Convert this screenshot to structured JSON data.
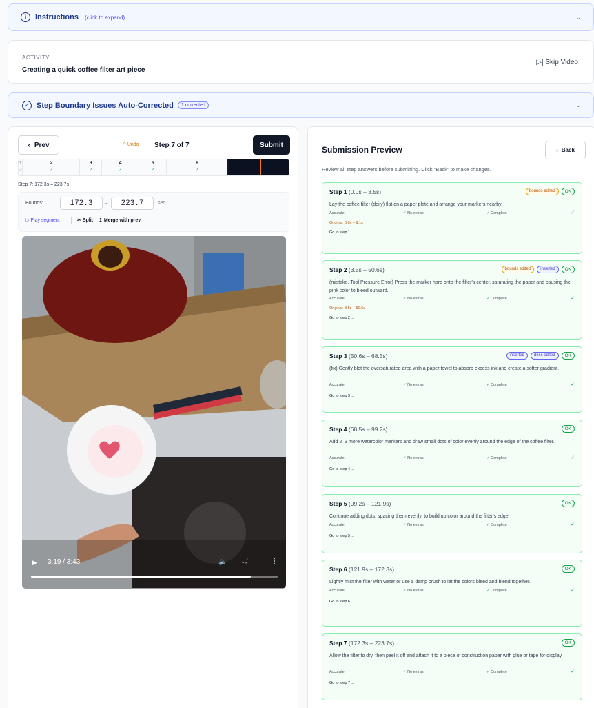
{
  "instructions": {
    "icon": "info-icon",
    "title": "Instructions",
    "hint": "(click to expand)"
  },
  "activity": {
    "label": "ACTIVITY",
    "value": "Creating a quick coffee filter art piece",
    "skip_label": "Skip Video"
  },
  "auto_correct": {
    "title": "Step Boundary Issues Auto-Corrected",
    "badge": "1 corrected"
  },
  "editor": {
    "prev_label": "Prev",
    "undo_label": "Undo",
    "step_title": "Step 7 of 7",
    "submit_label": "Submit",
    "timeline": [
      {
        "n": "1",
        "start": 0.0,
        "end": 3.5
      },
      {
        "n": "2",
        "start": 3.5,
        "end": 50.6
      },
      {
        "n": "3",
        "start": 50.6,
        "end": 68.5
      },
      {
        "n": "4",
        "start": 68.5,
        "end": 99.2
      },
      {
        "n": "5",
        "start": 99.2,
        "end": 121.9
      },
      {
        "n": "6",
        "start": 121.9,
        "end": 172.3
      },
      {
        "n": "7",
        "start": 172.3,
        "end": 223.7
      }
    ],
    "total_duration": 223.7,
    "current_time": 199,
    "range_label": "Step 7: 172.3s – 223.7s",
    "bounds_label": "Bounds:",
    "bound_start": "172.3",
    "bound_end": "223.7",
    "bound_dash": "–",
    "unit": "sec",
    "play_segment": "Play segment",
    "split": "Split",
    "merge": "Merge with prev",
    "video_time": "3:19 / 3:43",
    "video_progress": 0.892
  },
  "preview": {
    "title": "Submission Preview",
    "back_label": "Back",
    "subtitle": "Review all step answers before submitting. Click \"Back\" to make changes.",
    "steps": [
      {
        "title": "Step 1",
        "range": "(0.0s – 3.5s)",
        "tags": [
          "bounds edited"
        ],
        "ok": "OK",
        "desc": "Lay the coffee filter (doily) flat on a paper plate and arrange your markers nearby.",
        "accurate": "Accurate",
        "extras": "No extras",
        "complete": "Complete",
        "original": "Original: 0.0s – 9.1s",
        "goto": "Go to step 1 →"
      },
      {
        "title": "Step 2",
        "range": "(3.5s – 50.6s)",
        "tags": [
          "bounds edited",
          "inserted"
        ],
        "ok": "OK",
        "desc": "(mistake, Tool Pressure Error) Press the marker hard onto the filter's center, saturating the paper and causing the pink color to bleed outward.",
        "accurate": "Accurate",
        "extras": "No extras",
        "complete": "Complete",
        "original": "Original: 3.5s – 50.6s",
        "goto": "Go to step 2 →"
      },
      {
        "title": "Step 3",
        "range": "(50.6s – 68.5s)",
        "tags": [
          "inserted",
          "desc edited"
        ],
        "ok": "OK",
        "desc": "(fix) Gently blot the oversaturated area with a paper towel to absorb excess ink and create a softer gradient.",
        "accurate": "Accurate",
        "extras": "No extras",
        "complete": "Complete",
        "original": "",
        "goto": "Go to step 3 →"
      },
      {
        "title": "Step 4",
        "range": "(68.5s – 99.2s)",
        "tags": [],
        "ok": "OK",
        "desc": "Add 2–3 more watercolor markers and draw small dots of color evenly around the edge of the coffee filter.",
        "accurate": "Accurate",
        "extras": "No extras",
        "complete": "Complete",
        "original": "",
        "goto": "Go to step 4 →"
      },
      {
        "title": "Step 5",
        "range": "(99.2s – 121.9s)",
        "tags": [],
        "ok": "OK",
        "desc": "Continue adding dots, spacing them evenly, to build up color around the filter's edge.",
        "accurate": "Accurate",
        "extras": "No extras",
        "complete": "Complete",
        "original": "",
        "goto": "Go to step 5 →"
      },
      {
        "title": "Step 6",
        "range": "(121.9s – 172.3s)",
        "tags": [],
        "ok": "OK",
        "desc": "Lightly mist the filter with water or use a damp brush to let the colors bleed and blend together.",
        "accurate": "Accurate",
        "extras": "No extras",
        "complete": "Complete",
        "original": "",
        "goto": "Go to step 6 →"
      },
      {
        "title": "Step 7",
        "range": "(172.3s – 223.7s)",
        "tags": [],
        "ok": "OK",
        "desc": "Allow the filter to dry, then peel it off and attach it to a piece of construction paper with glue or tape for display.",
        "accurate": "Accurate",
        "extras": "No extras",
        "complete": "Complete",
        "original": "",
        "goto": "Go to step 7 →"
      }
    ]
  },
  "colors": {
    "accent": "#1e3a8a",
    "ok_green": "#16a34a",
    "edited_amber": "#b45309",
    "card_bg": "#f4fdf6"
  }
}
